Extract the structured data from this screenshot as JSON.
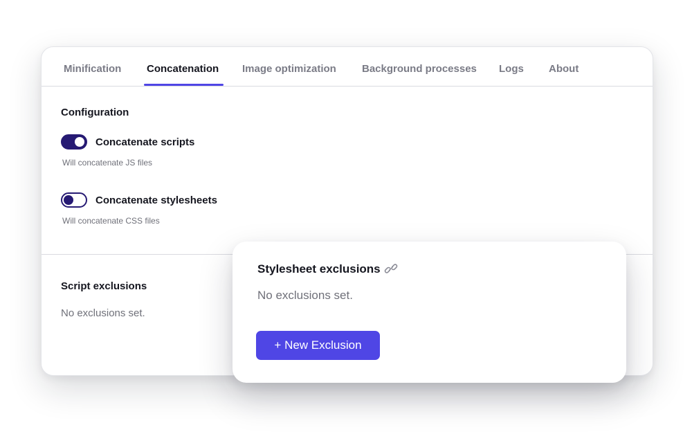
{
  "tabs": [
    {
      "label": "Minification"
    },
    {
      "label": "Concatenation"
    },
    {
      "label": "Image optimization"
    },
    {
      "label": "Background processes"
    },
    {
      "label": "Logs"
    },
    {
      "label": "About"
    }
  ],
  "active_tab": "Concatenation",
  "configuration": {
    "title": "Configuration",
    "toggles": [
      {
        "label": "Concatenate scripts",
        "helper": "Will concatenate JS files",
        "state": "on"
      },
      {
        "label": "Concatenate stylesheets",
        "helper": "Will concatenate CSS files",
        "state": "off"
      }
    ]
  },
  "script_exclusions": {
    "title": "Script exclusions",
    "empty_text": "No exclusions set."
  },
  "stylesheet_exclusions": {
    "title": "Stylesheet exclusions",
    "icon": "link-icon",
    "empty_text": "No exclusions set.",
    "button_label": "+ New Exclusion"
  },
  "colors": {
    "accent": "#4f46e5",
    "toggle": "#261a73",
    "text_primary": "#15161f",
    "text_muted": "#6f7079"
  }
}
